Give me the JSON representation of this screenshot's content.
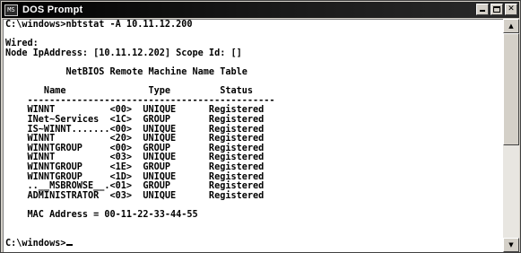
{
  "window": {
    "title": "DOS Prompt",
    "icon": "msdos-icon",
    "icon_glyph": "MS",
    "buttons": {
      "minimize": "minimize-icon",
      "maximize": "maximize-icon",
      "close": "close-icon",
      "close_glyph": "✕"
    }
  },
  "console": {
    "lines": [
      "C:\\windows>nbtstat -A 10.11.12.200",
      "",
      "Wired:",
      "Node IpAddress: [10.11.12.202] Scope Id: []",
      "",
      "           NetBIOS Remote Machine Name Table",
      "",
      "       Name               Type         Status",
      "    ---------------------------------------------",
      "    WINNT          <00>  UNIQUE      Registered",
      "    INet~Services  <1C>  GROUP       Registered",
      "    IS~WINNT.......<00>  UNIQUE      Registered",
      "    WINNT          <20>  UNIQUE      Registered",
      "    WINNTGROUP     <00>  GROUP       Registered",
      "    WINNT          <03>  UNIQUE      Registered",
      "    WINNTGROUP     <1E>  GROUP       Registered",
      "    WINNTGROUP     <1D>  UNIQUE      Registered",
      "    ..__MSBROWSE__.<01>  GROUP       Registered",
      "    ADMINISTRATOR  <03>  UNIQUE      Registered",
      "",
      "    MAC Address = 00-11-22-33-44-55",
      "",
      "",
      "C:\\windows>"
    ]
  },
  "scrollbar": {
    "up_glyph": "▲",
    "down_glyph": "▼",
    "thumb_position": 0.0,
    "thumb_fraction": 0.55
  }
}
